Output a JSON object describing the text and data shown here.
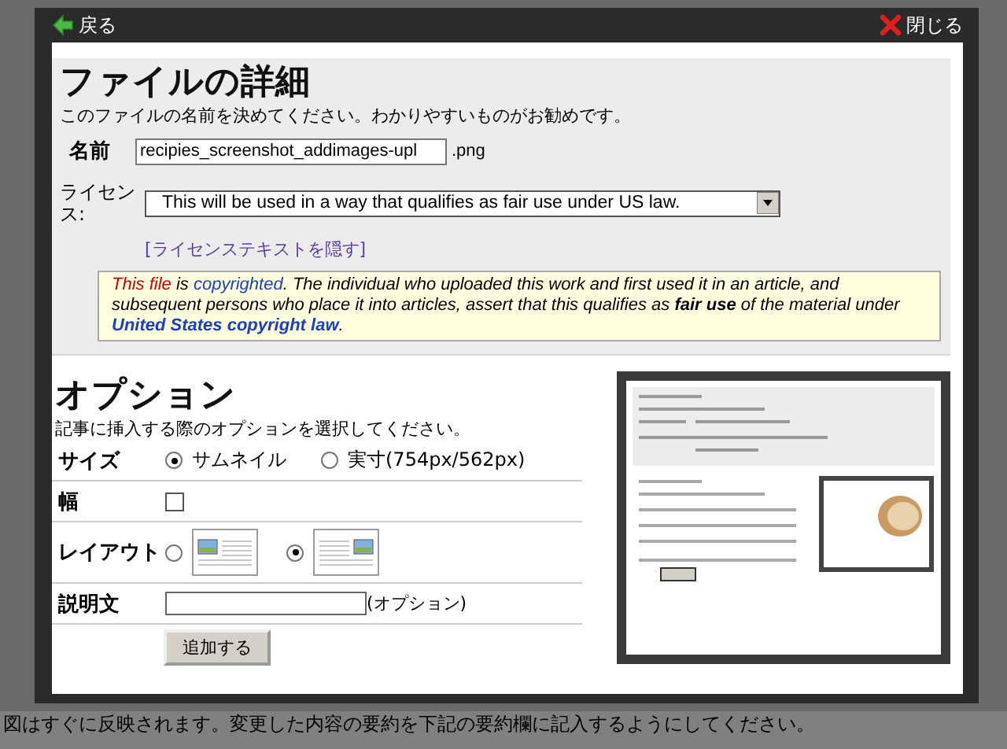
{
  "dialog": {
    "back_label": "戻る",
    "close_label": "閉じる"
  },
  "file_details": {
    "title": "ファイルの詳細",
    "description": "このファイルの名前を決めてください。わかりやすいものがお勧めです。",
    "name_label": "名前",
    "name_value": "recipies_screenshot_addimages-upl",
    "extension": ".png",
    "license_label": "ライセンス:",
    "license_value": "This will be used in a way that qualifies as fair use under US law.",
    "license_toggle": "[ライセンステキストを隠す]",
    "license_text": [
      {
        "kind": "missing-link",
        "text": "This file"
      },
      {
        "kind": "plain",
        "text": " is "
      },
      {
        "kind": "link",
        "text": "copyrighted"
      },
      {
        "kind": "plain",
        "text": ". The individual who uploaded this work and first used it in an article, and subsequent persons who place it into articles, assert that this qualifies as "
      },
      {
        "kind": "bold",
        "text": "fair use"
      },
      {
        "kind": "plain",
        "text": " of the material under "
      },
      {
        "kind": "bold-link",
        "text": "United States copyright law"
      },
      {
        "kind": "plain",
        "text": "."
      }
    ]
  },
  "options": {
    "title": "オプション",
    "description": "記事に挿入する際のオプションを選択してください。",
    "rows": [
      {
        "kind": "radio",
        "label": "サイズ",
        "choices": [
          {
            "label": "サムネイル",
            "selected": true
          },
          {
            "label": "実寸(754px/562px)",
            "selected": false
          }
        ]
      },
      {
        "kind": "checkbox",
        "label": "幅",
        "checked": false
      },
      {
        "kind": "layout",
        "label": "レイアウト",
        "choices": [
          {
            "kind": "image-left",
            "selected": false
          },
          {
            "kind": "image-right",
            "selected": true
          }
        ]
      },
      {
        "kind": "text",
        "label": "説明文",
        "hint": "(オプション)"
      }
    ],
    "submit": "追加する"
  },
  "page_footer": "図はすぐに反映されます。変更した内容の要約を下記の要約欄に記入するようにしてください。"
}
